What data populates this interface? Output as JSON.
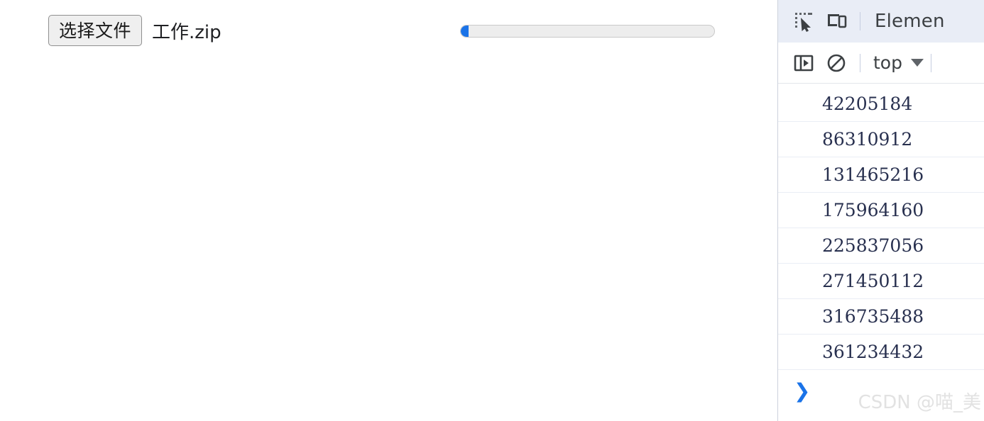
{
  "page": {
    "file_input": {
      "button_label": "选择文件",
      "file_name": "工作.zip"
    },
    "progress": {
      "value_percent": 3,
      "fill_color": "#1a73e8",
      "track_color": "#ededed"
    }
  },
  "devtools": {
    "toolbar": {
      "inspect_icon": "inspect-element-icon",
      "device_icon": "device-toggle-icon",
      "active_tab": "Elemen"
    },
    "console_toolbar": {
      "sidebar_icon": "console-sidebar-toggle-icon",
      "clear_icon": "clear-console-icon",
      "context_label": "top"
    },
    "console_messages": [
      {
        "value": "42205184"
      },
      {
        "value": "86310912"
      },
      {
        "value": "131465216"
      },
      {
        "value": "175964160"
      },
      {
        "value": "225837056"
      },
      {
        "value": "271450112"
      },
      {
        "value": "316735488"
      },
      {
        "value": "361234432"
      }
    ],
    "prompt": {
      "caret": "❯"
    }
  },
  "watermark": {
    "text": "CSDN @喵_美"
  }
}
